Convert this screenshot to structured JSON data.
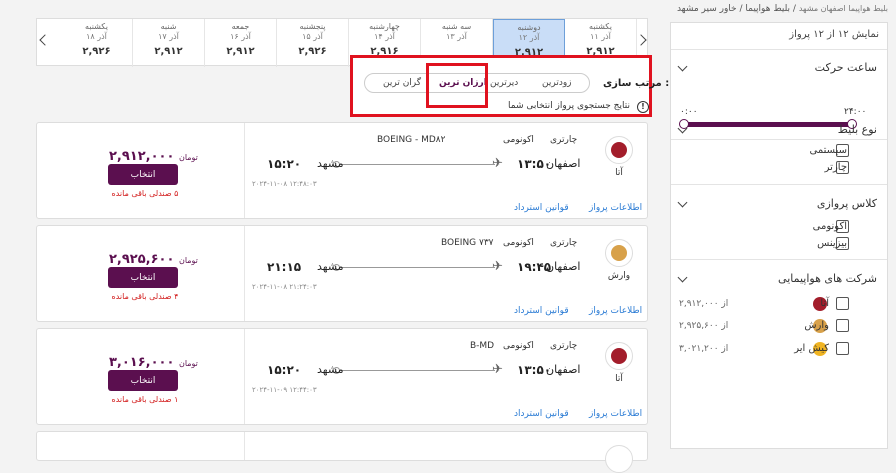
{
  "breadcrumb": {
    "items": [
      "خاور سیر مشهد",
      "بلیط هواپیما",
      "بلیط هواپیما اصفهان مشهد"
    ],
    "sep": " / "
  },
  "sidebar": {
    "count": "نمایش ۱۲ از ۱۲ پرواز",
    "time": {
      "title": "ساعت حرکت",
      "from": "۰:۰۰",
      "to": "۲۴:۰۰"
    },
    "ticket_type": {
      "title": "نوع بلیط",
      "options": [
        "سیستمی",
        "چارتر"
      ]
    },
    "flight_class": {
      "title": "کلاس پروازی",
      "options": [
        "اکونومی",
        "بیزینس"
      ]
    },
    "airlines": {
      "title": "شرکت های هواپیمایی",
      "items": [
        {
          "name": "آتا",
          "price": "از ۲,۹۱۲,۰۰۰",
          "color": "#a31d2b"
        },
        {
          "name": "وارش",
          "price": "از ۲,۹۲۵,۶۰۰",
          "color": "#d8a14a"
        },
        {
          "name": "کیش ایر",
          "price": "از ۳,۰۲۱,۲۰۰",
          "color": "#f0b423"
        }
      ]
    }
  },
  "dates": [
    {
      "day": "یکشنبه",
      "date": "۱۱ آذر",
      "price": "۲,۹۱۲"
    },
    {
      "day": "دوشنبه",
      "date": "۱۲ آذر",
      "price": "۲,۹۱۲"
    },
    {
      "day": "سه شنبه",
      "date": "۱۳ آذر",
      "price": ""
    },
    {
      "day": "چهارشنبه",
      "date": "۱۴ آذر",
      "price": "۲,۹۱۶"
    },
    {
      "day": "پنجشنبه",
      "date": "۱۵ آذر",
      "price": "۲,۹۲۶"
    },
    {
      "day": "جمعه",
      "date": "۱۶ آذر",
      "price": "۲,۹۱۲"
    },
    {
      "day": "شنبه",
      "date": "۱۷ آذر",
      "price": "۲,۹۱۲"
    },
    {
      "day": "یکشنبه",
      "date": "۱۸ آذر",
      "price": "۲,۹۲۶"
    }
  ],
  "sort": {
    "label": "مرتب سازی :",
    "options": [
      "زودترین",
      "دیرترین",
      "ارزان ترین",
      "گران ترین"
    ],
    "active": "ارزان ترین",
    "note": "نتایج جستجوی پرواز انتخابی شما"
  },
  "flights": [
    {
      "airline": "آتا",
      "logo_color": "#a31d2b",
      "type": "چارتری",
      "class": "اکونومی",
      "plane": "BOEING - MD۸۲",
      "from": "اصفهان",
      "dep": "۱۳:۵۰",
      "to": "مشهد",
      "arr": "۱۵:۲۰",
      "date": "۲۰۲۴-۱۱-۰۸ ۱۲:۴۸:۰۳",
      "price": "۲,۹۱۲,۰۰۰",
      "currency": "تومان",
      "select": "انتخاب",
      "seats": "۵ صندلی باقی مانده",
      "link_info": "اطلاعات پرواز",
      "link_refund": "قوانین استرداد"
    },
    {
      "airline": "وارش",
      "logo_color": "#d8a14a",
      "type": "چارتری",
      "class": "اکونومی",
      "plane": "BOEING ۷۳۷",
      "from": "اصفهان",
      "dep": "۱۹:۴۵",
      "to": "مشهد",
      "arr": "۲۱:۱۵",
      "date": "۲۰۲۴-۱۱-۰۸ ۲۱:۲۴:۰۳",
      "price": "۲,۹۲۵,۶۰۰",
      "currency": "تومان",
      "select": "انتخاب",
      "seats": "۴ صندلی باقی مانده",
      "link_info": "اطلاعات پرواز",
      "link_refund": "قوانین استرداد"
    },
    {
      "airline": "آتا",
      "logo_color": "#a31d2b",
      "type": "چارتری",
      "class": "اکونومی",
      "plane": "B-MD",
      "from": "اصفهان",
      "dep": "۱۳:۵۰",
      "to": "مشهد",
      "arr": "۱۵:۲۰",
      "date": "۲۰۲۴-۱۱-۰۹ ۱۲:۴۴:۰۳",
      "price": "۳,۰۱۶,۰۰۰",
      "currency": "تومان",
      "select": "انتخاب",
      "seats": "۱ صندلی باقی مانده",
      "link_info": "اطلاعات پرواز",
      "link_refund": "قوانین استرداد"
    }
  ]
}
